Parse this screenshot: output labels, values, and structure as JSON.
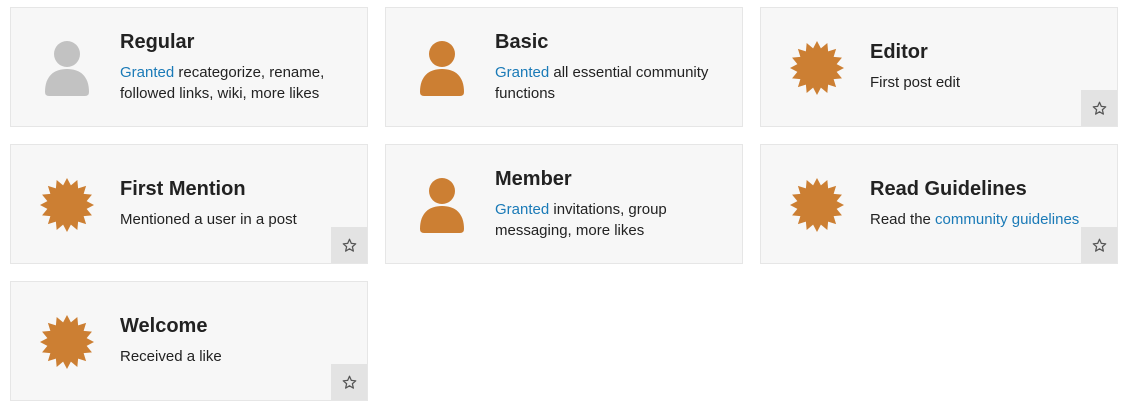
{
  "colors": {
    "badge": "#cc7f33",
    "regular_icon": "#c2c2c2",
    "link": "#1a7ab7"
  },
  "badges": [
    {
      "title": "Regular",
      "icon": "user-icon",
      "link": "Granted",
      "text": " recategorize, rename, followed links, wiki, more likes"
    },
    {
      "title": "Basic",
      "icon": "user-icon",
      "link": "Granted",
      "text": " all essential community functions"
    },
    {
      "title": "Editor",
      "icon": "badge-burst-icon",
      "text": "First post edit",
      "favorite_icon": "star-icon"
    },
    {
      "title": "First Mention",
      "icon": "badge-burst-icon",
      "text": "Mentioned a user in a post",
      "favorite_icon": "star-icon"
    },
    {
      "title": "Member",
      "icon": "user-icon",
      "link": "Granted",
      "text": " invitations, group messaging, more likes"
    },
    {
      "title": "Read Guidelines",
      "icon": "badge-burst-icon",
      "text": "Read the ",
      "link": "community guidelines",
      "favorite_icon": "star-icon"
    },
    {
      "title": "Welcome",
      "icon": "badge-burst-icon",
      "text": "Received a like",
      "favorite_icon": "star-icon"
    }
  ]
}
